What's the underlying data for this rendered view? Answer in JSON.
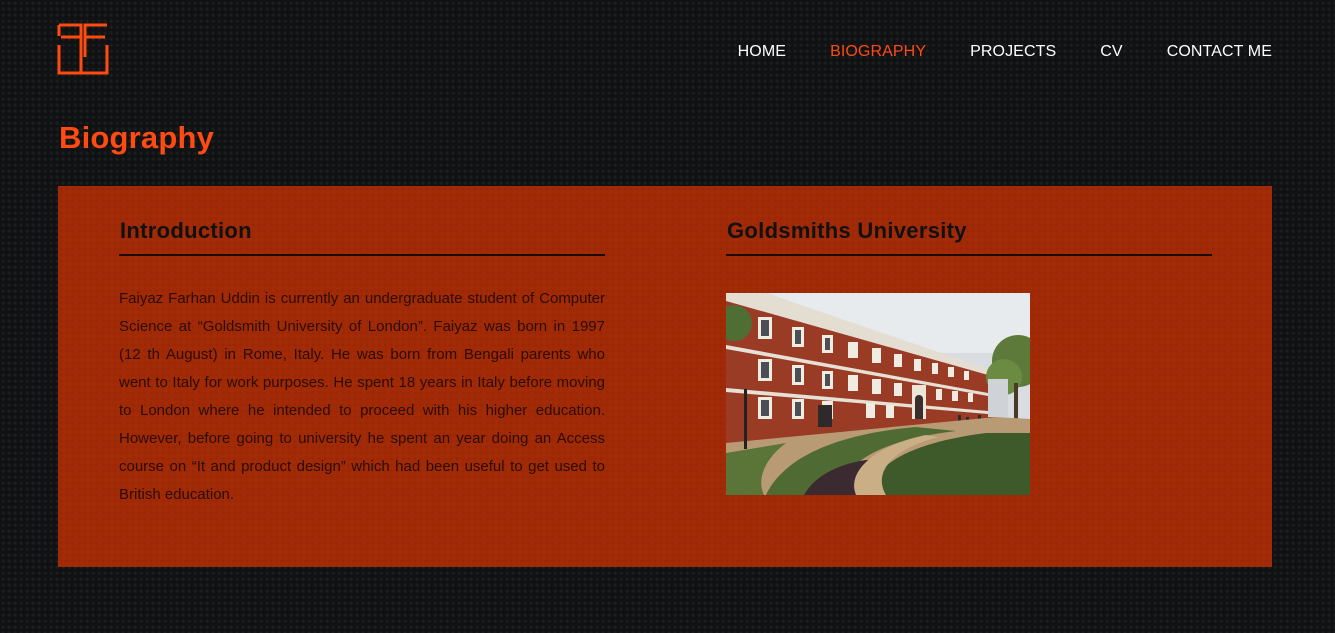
{
  "header": {
    "logo_icon": "ff-monogram-logo-icon",
    "nav": [
      {
        "label": "HOME",
        "active": false
      },
      {
        "label": "BIOGRAPHY",
        "active": true
      },
      {
        "label": "PROJECTS",
        "active": false
      },
      {
        "label": "CV",
        "active": false
      },
      {
        "label": "CONTACT ME",
        "active": false
      }
    ]
  },
  "page": {
    "title": "Biography"
  },
  "introduction": {
    "heading": "Introduction",
    "text": "Faiyaz Farhan Uddin is currently an undergraduate student of Computer Science at “Goldsmith University of London”. Faiyaz was born in 1997 (12 th August) in Rome, Italy. He was born from Bengali parents who went to Italy for work purposes. He spent 18 years in Italy before moving to London where he intended to proceed with his higher education. However, before going to university he spent an year doing an Access course on “It and product design” which had been useful to get used to British education."
  },
  "university": {
    "heading": "Goldsmiths University",
    "photo_icon": "campus-building-photo"
  },
  "colors": {
    "accent": "#ff4a12",
    "panel": "#a32a06",
    "background": "#0f1113",
    "nav_text": "#ffffff"
  }
}
